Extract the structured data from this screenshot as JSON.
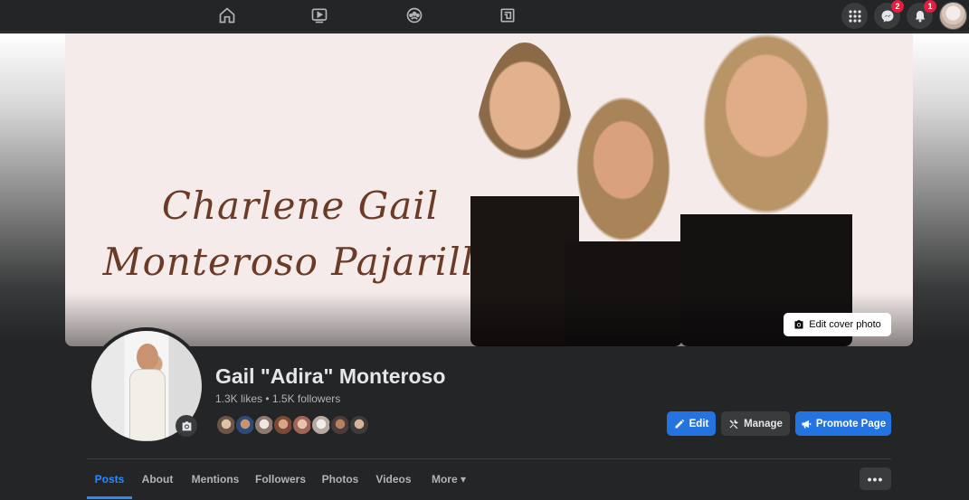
{
  "nav": {
    "icons": [
      "home-icon",
      "watch-icon",
      "groups-icon",
      "gaming-icon"
    ],
    "right_icons": [
      "menu-grid-icon",
      "messenger-icon",
      "notifications-icon",
      "account-avatar"
    ],
    "messenger_badge": "2",
    "notifications_badge": "1"
  },
  "cover": {
    "title_line1": "Charlene Gail",
    "title_line2": "Monteroso Pajarillo",
    "edit_cover_label": "Edit cover photo"
  },
  "profile": {
    "name": "Gail \"Adira\" Monteroso",
    "stats": "1.3K likes • 1.5K followers"
  },
  "actions": {
    "edit_label": "Edit",
    "manage_label": "Manage",
    "promote_label": "Promote Page"
  },
  "tabs": [
    {
      "label": "Posts"
    },
    {
      "label": "About"
    },
    {
      "label": "Mentions"
    },
    {
      "label": "Followers"
    },
    {
      "label": "Photos"
    },
    {
      "label": "Videos"
    },
    {
      "label": "More ▾"
    }
  ],
  "more_button": "•••",
  "colors": {
    "accent": "#2374e1",
    "tab_active": "#2d88ff",
    "surface": "#242526",
    "badge": "#e41e3f",
    "cover_text": "#6b3b28"
  }
}
